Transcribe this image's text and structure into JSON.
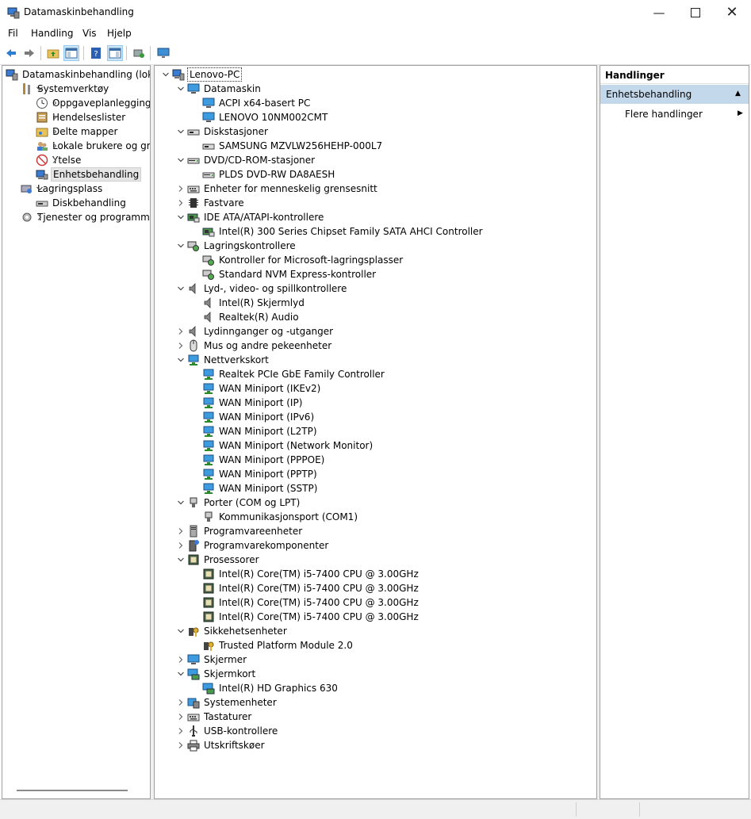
{
  "window": {
    "title": "Datamaskinbehandling"
  },
  "menu": [
    "Fil",
    "Handling",
    "Vis",
    "Hjelp"
  ],
  "toolbar": [
    "back-icon",
    "forward-icon",
    "up-folder-icon",
    "show-hide-tree-icon",
    "help-icon",
    "show-hide-action-icon",
    "scan-hardware-icon",
    "monitor-icon"
  ],
  "nav_tree": [
    {
      "label": "Datamaskinbehandling (lokal)",
      "level": 0,
      "toggle": "",
      "icon": "computer-management-icon"
    },
    {
      "label": "Systemverktøy",
      "level": 1,
      "toggle": "open",
      "icon": "tools-icon"
    },
    {
      "label": "Oppgaveplanlegging",
      "level": 2,
      "toggle": "closed",
      "icon": "clock-icon"
    },
    {
      "label": "Hendelseslister",
      "level": 2,
      "toggle": "closed",
      "icon": "event-log-icon"
    },
    {
      "label": "Delte mapper",
      "level": 2,
      "toggle": "closed",
      "icon": "shared-folder-icon"
    },
    {
      "label": "Lokale brukere og grupper",
      "level": 2,
      "toggle": "closed",
      "icon": "users-icon"
    },
    {
      "label": "Ytelse",
      "level": 2,
      "toggle": "closed",
      "icon": "performance-icon"
    },
    {
      "label": "Enhetsbehandling",
      "level": 2,
      "toggle": "",
      "icon": "device-manager-icon",
      "selected": true
    },
    {
      "label": "Lagringsplass",
      "level": 1,
      "toggle": "open",
      "icon": "storage-icon"
    },
    {
      "label": "Diskbehandling",
      "level": 2,
      "toggle": "",
      "icon": "disk-icon"
    },
    {
      "label": "Tjenester og programmer",
      "level": 1,
      "toggle": "closed",
      "icon": "services-icon"
    }
  ],
  "device_tree": [
    {
      "label": "Lenovo-PC",
      "level": 0,
      "toggle": "open",
      "icon": "computer-icon",
      "focus": true
    },
    {
      "label": "Datamaskin",
      "level": 1,
      "toggle": "open",
      "icon": "monitor-icon"
    },
    {
      "label": "ACPI x64-basert PC",
      "level": 2,
      "toggle": "",
      "icon": "monitor-icon"
    },
    {
      "label": "LENOVO 10NM002CMT",
      "level": 2,
      "toggle": "",
      "icon": "monitor-icon"
    },
    {
      "label": "Diskstasjoner",
      "level": 1,
      "toggle": "open",
      "icon": "drive-icon"
    },
    {
      "label": "SAMSUNG MZVLW256HEHP-000L7",
      "level": 2,
      "toggle": "",
      "icon": "drive-icon"
    },
    {
      "label": "DVD/CD-ROM-stasjoner",
      "level": 1,
      "toggle": "open",
      "icon": "dvd-icon"
    },
    {
      "label": "PLDS DVD-RW DA8AESH",
      "level": 2,
      "toggle": "",
      "icon": "dvd-icon"
    },
    {
      "label": "Enheter for menneskelig grensesnitt",
      "level": 1,
      "toggle": "closed",
      "icon": "keyboard-icon"
    },
    {
      "label": "Fastvare",
      "level": 1,
      "toggle": "closed",
      "icon": "chip-icon"
    },
    {
      "label": "IDE ATA/ATAPI-kontrollere",
      "level": 1,
      "toggle": "open",
      "icon": "controller-icon"
    },
    {
      "label": "Intel(R) 300 Series Chipset Family SATA AHCI Controller",
      "level": 2,
      "toggle": "",
      "icon": "controller-icon"
    },
    {
      "label": "Lagringskontrollere",
      "level": 1,
      "toggle": "open",
      "icon": "storage-controller-icon"
    },
    {
      "label": "Kontroller for Microsoft-lagringsplasser",
      "level": 2,
      "toggle": "",
      "icon": "storage-controller-icon"
    },
    {
      "label": "Standard NVM Express-kontroller",
      "level": 2,
      "toggle": "",
      "icon": "storage-controller-icon"
    },
    {
      "label": "Lyd-, video- og spillkontrollere",
      "level": 1,
      "toggle": "open",
      "icon": "speaker-icon"
    },
    {
      "label": "Intel(R) Skjermlyd",
      "level": 2,
      "toggle": "",
      "icon": "speaker-icon"
    },
    {
      "label": "Realtek(R) Audio",
      "level": 2,
      "toggle": "",
      "icon": "speaker-icon"
    },
    {
      "label": "Lydinnganger og -utganger",
      "level": 1,
      "toggle": "closed",
      "icon": "speaker-icon"
    },
    {
      "label": "Mus og andre pekeenheter",
      "level": 1,
      "toggle": "closed",
      "icon": "mouse-icon"
    },
    {
      "label": "Nettverkskort",
      "level": 1,
      "toggle": "open",
      "icon": "network-icon"
    },
    {
      "label": "Realtek PCIe GbE Family Controller",
      "level": 2,
      "toggle": "",
      "icon": "network-icon"
    },
    {
      "label": "WAN Miniport (IKEv2)",
      "level": 2,
      "toggle": "",
      "icon": "network-icon"
    },
    {
      "label": "WAN Miniport (IP)",
      "level": 2,
      "toggle": "",
      "icon": "network-icon"
    },
    {
      "label": "WAN Miniport (IPv6)",
      "level": 2,
      "toggle": "",
      "icon": "network-icon"
    },
    {
      "label": "WAN Miniport (L2TP)",
      "level": 2,
      "toggle": "",
      "icon": "network-icon"
    },
    {
      "label": "WAN Miniport (Network Monitor)",
      "level": 2,
      "toggle": "",
      "icon": "network-icon"
    },
    {
      "label": "WAN Miniport (PPPOE)",
      "level": 2,
      "toggle": "",
      "icon": "network-icon"
    },
    {
      "label": "WAN Miniport (PPTP)",
      "level": 2,
      "toggle": "",
      "icon": "network-icon"
    },
    {
      "label": "WAN Miniport (SSTP)",
      "level": 2,
      "toggle": "",
      "icon": "network-icon"
    },
    {
      "label": "Porter (COM og LPT)",
      "level": 1,
      "toggle": "open",
      "icon": "port-icon"
    },
    {
      "label": "Kommunikasjonsport (COM1)",
      "level": 2,
      "toggle": "",
      "icon": "port-icon"
    },
    {
      "label": "Programvareenheter",
      "level": 1,
      "toggle": "closed",
      "icon": "software-device-icon"
    },
    {
      "label": "Programvarekomponenter",
      "level": 1,
      "toggle": "closed",
      "icon": "software-component-icon"
    },
    {
      "label": "Prosessorer",
      "level": 1,
      "toggle": "open",
      "icon": "cpu-icon"
    },
    {
      "label": "Intel(R) Core(TM) i5-7400 CPU @ 3.00GHz",
      "level": 2,
      "toggle": "",
      "icon": "cpu-icon"
    },
    {
      "label": "Intel(R) Core(TM) i5-7400 CPU @ 3.00GHz",
      "level": 2,
      "toggle": "",
      "icon": "cpu-icon"
    },
    {
      "label": "Intel(R) Core(TM) i5-7400 CPU @ 3.00GHz",
      "level": 2,
      "toggle": "",
      "icon": "cpu-icon"
    },
    {
      "label": "Intel(R) Core(TM) i5-7400 CPU @ 3.00GHz",
      "level": 2,
      "toggle": "",
      "icon": "cpu-icon"
    },
    {
      "label": "Sikkehetsenheter",
      "level": 1,
      "toggle": "open",
      "icon": "security-icon"
    },
    {
      "label": "Trusted Platform Module 2.0",
      "level": 2,
      "toggle": "",
      "icon": "security-icon"
    },
    {
      "label": "Skjermer",
      "level": 1,
      "toggle": "closed",
      "icon": "monitor-icon"
    },
    {
      "label": "Skjermkort",
      "level": 1,
      "toggle": "open",
      "icon": "display-adapter-icon"
    },
    {
      "label": "Intel(R) HD Graphics 630",
      "level": 2,
      "toggle": "",
      "icon": "display-adapter-icon"
    },
    {
      "label": "Systemenheter",
      "level": 1,
      "toggle": "closed",
      "icon": "system-device-icon"
    },
    {
      "label": "Tastaturer",
      "level": 1,
      "toggle": "closed",
      "icon": "keyboard-icon"
    },
    {
      "label": "USB-kontrollere",
      "level": 1,
      "toggle": "closed",
      "icon": "usb-icon"
    },
    {
      "label": "Utskriftskøer",
      "level": 1,
      "toggle": "closed",
      "icon": "printer-icon"
    }
  ],
  "actions": {
    "header": "Handlinger",
    "section": "Enhetsbehandling",
    "more": "Flere handlinger"
  },
  "colors": {
    "accent": "#1e6fc2",
    "selection": "#e5e5e5",
    "actions_section_bg": "#c4d8ec"
  }
}
